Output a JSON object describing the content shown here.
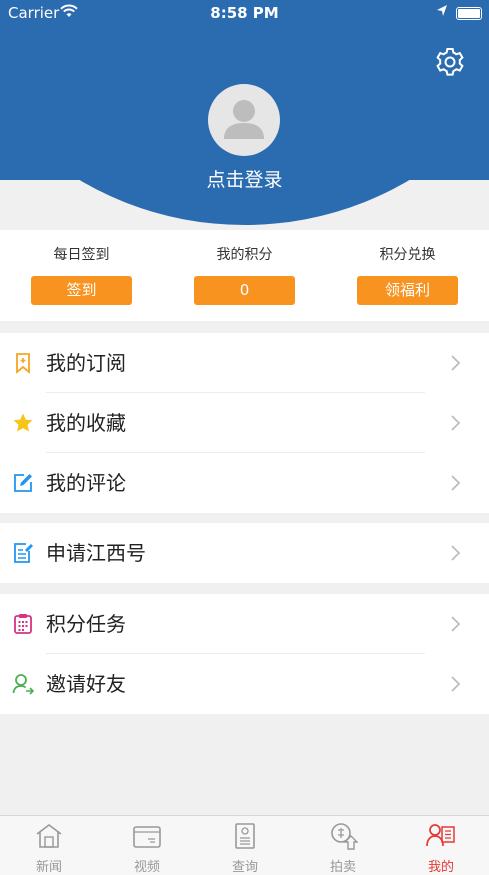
{
  "status_bar": {
    "carrier": "Carrier",
    "time": "8:58 PM"
  },
  "profile": {
    "login_text": "点击登录"
  },
  "points": [
    {
      "label": "每日签到",
      "button": "签到"
    },
    {
      "label": "我的积分",
      "button": "0"
    },
    {
      "label": "积分兑换",
      "button": "领福利"
    }
  ],
  "menu": {
    "group1": [
      {
        "label": "我的订阅",
        "icon": "bookmark-plus-icon"
      },
      {
        "label": "我的收藏",
        "icon": "star-icon"
      },
      {
        "label": "我的评论",
        "icon": "edit-icon"
      }
    ],
    "group2": [
      {
        "label": "申请江西号",
        "icon": "document-edit-icon"
      }
    ],
    "group3": [
      {
        "label": "积分任务",
        "icon": "calendar-icon"
      },
      {
        "label": "邀请好友",
        "icon": "add-user-icon"
      }
    ]
  },
  "tabs": [
    {
      "label": "新闻",
      "icon": "home-icon"
    },
    {
      "label": "视频",
      "icon": "video-folder-icon"
    },
    {
      "label": "查询",
      "icon": "id-card-icon"
    },
    {
      "label": "拍卖",
      "icon": "auction-icon"
    },
    {
      "label": "我的",
      "icon": "profile-icon"
    }
  ],
  "colors": {
    "header_blue": "#2b6cb0",
    "accent_orange": "#f7931e",
    "active_red": "#e53935"
  }
}
